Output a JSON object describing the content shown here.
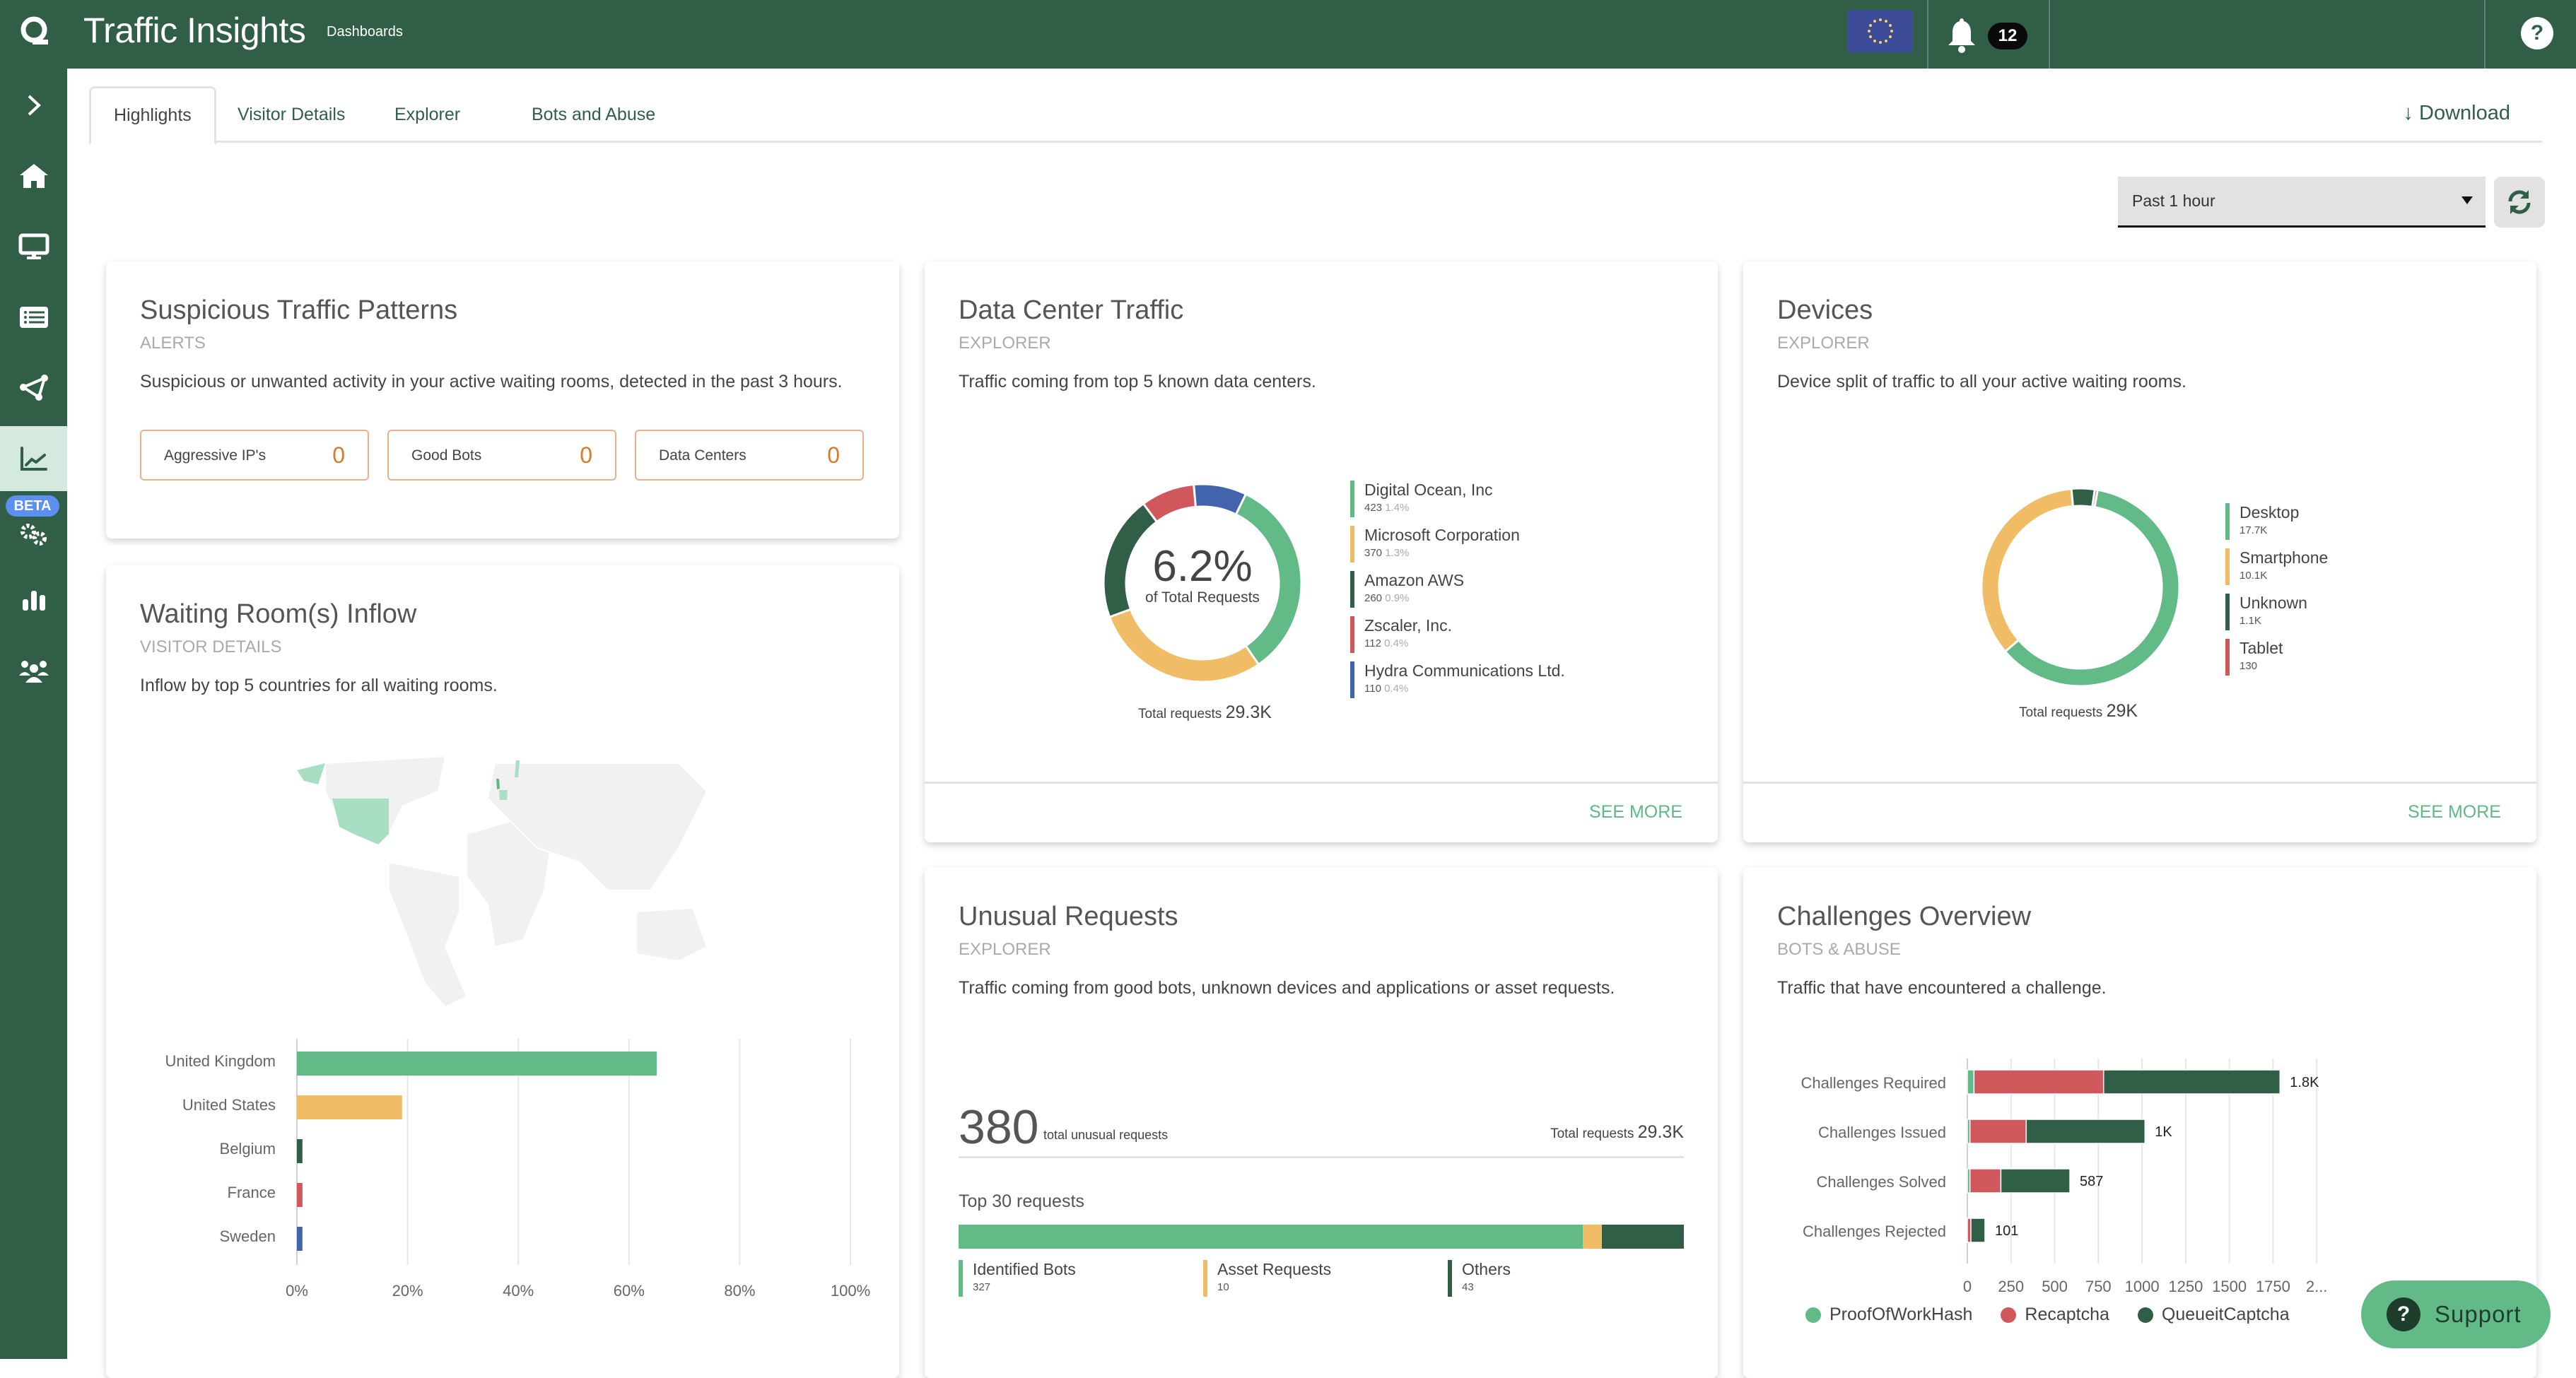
{
  "header": {
    "title": "Traffic Insights",
    "subtitle": "Dashboards",
    "notifications_count": "12",
    "help_label": "?"
  },
  "sidebar": {
    "items": [
      {
        "name": "expand",
        "icon": "chevron-right-icon"
      },
      {
        "name": "home",
        "icon": "home-icon"
      },
      {
        "name": "monitor",
        "icon": "monitor-icon"
      },
      {
        "name": "list",
        "icon": "list-icon"
      },
      {
        "name": "routes",
        "icon": "share-nodes-icon"
      },
      {
        "name": "traffic-insights",
        "icon": "chart-line-icon",
        "active": true
      },
      {
        "name": "settings-beta",
        "icon": "gears-icon",
        "badge": "BETA"
      },
      {
        "name": "reports",
        "icon": "bar-chart-icon"
      },
      {
        "name": "users",
        "icon": "users-icon"
      }
    ]
  },
  "tabs": [
    {
      "label": "Highlights",
      "active": true
    },
    {
      "label": "Visitor Details"
    },
    {
      "label": "Explorer"
    },
    {
      "label": "Bots and Abuse"
    }
  ],
  "toolbar": {
    "download_label": "Download",
    "time_range": "Past 1 hour"
  },
  "colors": {
    "brand": "#315e47",
    "green": "#62ba86",
    "yellow": "#f0bd66",
    "dark_green": "#315e47",
    "red": "#d0585c",
    "blue": "#4264ad",
    "alert_orange": "#d87a2c"
  },
  "suspicious": {
    "title": "Suspicious Traffic Patterns",
    "category": "ALERTS",
    "description": "Suspicious or unwanted activity in your active waiting rooms, detected in the past 3 hours.",
    "boxes": [
      {
        "label": "Aggressive IP's",
        "value": "0"
      },
      {
        "label": "Good Bots",
        "value": "0"
      },
      {
        "label": "Data Centers",
        "value": "0"
      }
    ]
  },
  "datacenter": {
    "title": "Data Center Traffic",
    "category": "EXPLORER",
    "description": "Traffic coming from top 5 known data centers.",
    "center_value": "6.2%",
    "center_label": "of Total Requests",
    "total_label": "Total requests",
    "total_value": "29.3K",
    "see_more": "SEE MORE"
  },
  "devices": {
    "title": "Devices",
    "category": "EXPLORER",
    "description": "Device split of traffic to all your active waiting rooms.",
    "total_label": "Total requests",
    "total_value": "29K",
    "see_more": "SEE MORE"
  },
  "inflow": {
    "title": "Waiting Room(s) Inflow",
    "category": "VISITOR DETAILS",
    "description": "Inflow by top 5 countries for all waiting rooms.",
    "map_highlighted": [
      "United Kingdom",
      "United States",
      "Belgium",
      "France",
      "Sweden"
    ]
  },
  "unusual": {
    "title": "Unusual Requests",
    "category": "EXPLORER",
    "description": "Traffic coming from good bots, unknown devices and applications or asset requests.",
    "total_unusual": "380",
    "total_unusual_label": "total unusual requests",
    "total_label": "Total requests",
    "total_value": "29.3K",
    "top_label": "Top 30 requests"
  },
  "challenges": {
    "title": "Challenges Overview",
    "category": "BOTS & ABUSE",
    "description": "Traffic that have encountered a challenge."
  },
  "support": {
    "label": "Support"
  },
  "chart_data": [
    {
      "id": "datacenter",
      "type": "pie",
      "variant": "donut",
      "categories": [
        "Digital Ocean, Inc",
        "Microsoft Corporation",
        "Amazon AWS",
        "Zscaler, Inc.",
        "Hydra Communications Ltd."
      ],
      "values": [
        423,
        370,
        260,
        112,
        110
      ],
      "percent_labels": [
        "1.4%",
        "1.3%",
        "0.9%",
        "0.4%",
        "0.4%"
      ],
      "colors": [
        "#62ba86",
        "#f0bd66",
        "#315e47",
        "#d0585c",
        "#4264ad"
      ],
      "legend": "right"
    },
    {
      "id": "devices",
      "type": "pie",
      "variant": "donut",
      "categories": [
        "Desktop",
        "Smartphone",
        "Unknown",
        "Tablet"
      ],
      "values": [
        17700,
        10100,
        1100,
        130
      ],
      "value_labels": [
        "17.7K",
        "10.1K",
        "1.1K",
        "130"
      ],
      "colors": [
        "#62ba86",
        "#f0bd66",
        "#315e47",
        "#d0585c"
      ],
      "legend": "right"
    },
    {
      "id": "inflow",
      "type": "bar",
      "orientation": "horizontal",
      "categories": [
        "United Kingdom",
        "United States",
        "Belgium",
        "France",
        "Sweden"
      ],
      "values": [
        65,
        19,
        1,
        1,
        1
      ],
      "colors": [
        "#62ba86",
        "#f0bd66",
        "#315e47",
        "#d0585c",
        "#4264ad"
      ],
      "xlim": [
        0,
        100
      ],
      "xticks": [
        "0%",
        "20%",
        "40%",
        "60%",
        "80%",
        "100%"
      ],
      "grid": true
    },
    {
      "id": "unusual",
      "type": "bar",
      "variant": "stacked-100",
      "categories": [
        "Identified Bots",
        "Asset Requests",
        "Others"
      ],
      "values": [
        327,
        10,
        43
      ],
      "colors": [
        "#62ba86",
        "#f0bd66",
        "#315e47"
      ]
    },
    {
      "id": "challenges",
      "type": "bar",
      "orientation": "horizontal",
      "variant": "stacked",
      "categories": [
        "Challenges Required",
        "Challenges Issued",
        "Challenges Solved",
        "Challenges Rejected"
      ],
      "series": [
        {
          "name": "ProofOfWorkHash",
          "color": "#62ba86",
          "values": [
            38,
            15,
            15,
            0
          ]
        },
        {
          "name": "Recaptcha",
          "color": "#d0585c",
          "values": [
            742,
            322,
            177,
            20
          ]
        },
        {
          "name": "QueueitCaptcha",
          "color": "#315e47",
          "values": [
            1010,
            680,
            395,
            81
          ]
        }
      ],
      "total_labels": [
        "1.8K",
        "1K",
        "587",
        "101"
      ],
      "xlim": [
        0,
        2000
      ],
      "xticks": [
        "0",
        "250",
        "500",
        "750",
        "1000",
        "1250",
        "1500",
        "1750",
        "2..."
      ],
      "grid": true,
      "legend": "bottom"
    }
  ]
}
